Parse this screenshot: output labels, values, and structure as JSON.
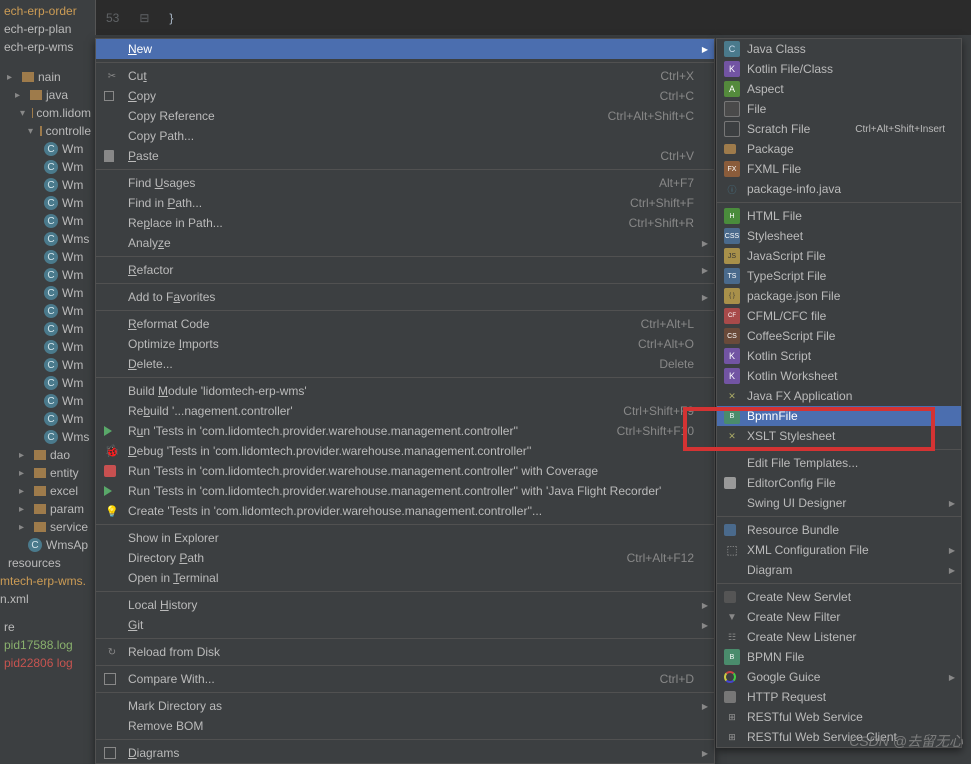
{
  "editor": {
    "line_number": "53",
    "code": "}"
  },
  "tree": {
    "projects": [
      {
        "label": "ech-erp-order",
        "cls": "ylw"
      },
      {
        "label": "ech-erp-plan",
        "cls": ""
      },
      {
        "label": "ech-erp-wms",
        "cls": ""
      }
    ],
    "main_nodes": [
      {
        "label": "nain",
        "indent": 0,
        "icon": "fld"
      },
      {
        "label": "java",
        "indent": 8,
        "icon": "fld"
      },
      {
        "label": "com.lidom",
        "indent": 16,
        "icon": "fld-open"
      },
      {
        "label": "controlle",
        "indent": 24,
        "icon": "fld-open"
      }
    ],
    "wms_items": [
      "Wm",
      "Wm",
      "Wm",
      "Wm",
      "Wm",
      "Wms",
      "Wm",
      "Wm",
      "Wm",
      "Wm",
      "Wm",
      "Wm",
      "Wm",
      "Wm",
      "Wm",
      "Wm",
      "Wms"
    ],
    "dao_folders": [
      {
        "label": "dao"
      },
      {
        "label": "entity"
      },
      {
        "label": "excel"
      },
      {
        "label": "param"
      },
      {
        "label": "service"
      }
    ],
    "wms_app": "WmsAp",
    "resources": "resources",
    "erp_wms": "mtech-erp-wms.",
    "xml": "n.xml",
    "re_label": "re",
    "logs": [
      {
        "label": "pid17588.log",
        "cls": "grn"
      },
      {
        "label": "pid22806 log",
        "cls": "red"
      }
    ]
  },
  "ctx_groups": [
    [
      {
        "label": "New",
        "underline_idx": 0,
        "shortcut": "",
        "arrow": true,
        "highlight": true
      }
    ],
    [
      {
        "label": "Cut",
        "underline_idx": 2,
        "shortcut": "Ctrl+X",
        "icon": "scissors"
      },
      {
        "label": "Copy",
        "underline_idx": 0,
        "shortcut": "Ctrl+C",
        "icon": "copy"
      },
      {
        "label": "Copy Reference",
        "shortcut": "Ctrl+Alt+Shift+C"
      },
      {
        "label": "Copy Path...",
        "shortcut": ""
      },
      {
        "label": "Paste",
        "underline_idx": 0,
        "shortcut": "Ctrl+V",
        "icon": "paste"
      }
    ],
    [
      {
        "label": "Find Usages",
        "underline_idx": 5,
        "shortcut": "Alt+F7"
      },
      {
        "label": "Find in Path...",
        "underline_idx": 8,
        "shortcut": "Ctrl+Shift+F"
      },
      {
        "label": "Replace in Path...",
        "underline_idx": 2,
        "shortcut": "Ctrl+Shift+R"
      },
      {
        "label": "Analyze",
        "underline_idx": 5,
        "shortcut": "",
        "arrow": true
      }
    ],
    [
      {
        "label": "Refactor",
        "underline_idx": 0,
        "shortcut": "",
        "arrow": true
      }
    ],
    [
      {
        "label": "Add to Favorites",
        "underline_idx": 8,
        "shortcut": "",
        "arrow": true
      }
    ],
    [
      {
        "label": "Reformat Code",
        "underline_idx": 0,
        "shortcut": "Ctrl+Alt+L"
      },
      {
        "label": "Optimize Imports",
        "underline_idx": 9,
        "shortcut": "Ctrl+Alt+O"
      },
      {
        "label": "Delete...",
        "underline_idx": 0,
        "shortcut": "Delete"
      }
    ],
    [
      {
        "label": "Build Module 'lidomtech-erp-wms'",
        "underline_idx": 6
      },
      {
        "label": "Rebuild '...nagement.controller'",
        "underline_idx": 2,
        "shortcut": "Ctrl+Shift+F9"
      },
      {
        "label": "Run 'Tests in 'com.lidomtech.provider.warehouse.management.controller''",
        "underline_idx": 1,
        "shortcut": "Ctrl+Shift+F10",
        "icon": "run"
      },
      {
        "label": "Debug 'Tests in 'com.lidomtech.provider.warehouse.management.controller''",
        "underline_idx": 0,
        "icon": "debug"
      },
      {
        "label": "Run 'Tests in 'com.lidomtech.provider.warehouse.management.controller'' with Coverage",
        "underline_idx": 83,
        "icon": "cov"
      },
      {
        "label": "Run 'Tests in 'com.lidomtech.provider.warehouse.management.controller'' with 'Java Flight Recorder'",
        "icon": "run"
      },
      {
        "label": "Create 'Tests in 'com.lidomtech.provider.warehouse.management.controller''...",
        "icon": "bulb"
      }
    ],
    [
      {
        "label": "Show in Explorer"
      },
      {
        "label": "Directory Path",
        "underline_idx": 10,
        "shortcut": "Ctrl+Alt+F12"
      },
      {
        "label": "Open in Terminal",
        "underline_idx": 8
      }
    ],
    [
      {
        "label": "Local History",
        "underline_idx": 6,
        "arrow": true
      },
      {
        "label": "Git",
        "underline_idx": 0,
        "arrow": true
      }
    ],
    [
      {
        "label": "Reload from Disk",
        "icon": "sync"
      }
    ],
    [
      {
        "label": "Compare With...",
        "shortcut": "Ctrl+D",
        "icon": "diag"
      }
    ],
    [
      {
        "label": "Mark Directory as",
        "arrow": true
      },
      {
        "label": "Remove BOM"
      }
    ],
    [
      {
        "label": "Diagrams",
        "underline_idx": 0,
        "arrow": true,
        "icon": "diag"
      }
    ]
  ],
  "submenu": [
    [
      {
        "label": "Java Class",
        "icon": "i-java",
        "icon_text": "C"
      },
      {
        "label": "Kotlin File/Class",
        "icon": "i-kotlin",
        "icon_text": "K"
      },
      {
        "label": "Aspect",
        "icon": "i-aspect",
        "icon_text": "A"
      },
      {
        "label": "File",
        "icon": "i-file"
      },
      {
        "label": "Scratch File",
        "icon": "i-scratch",
        "shortcut": "Ctrl+Alt+Shift+Insert"
      },
      {
        "label": "Package",
        "icon": "i-pkg"
      },
      {
        "label": "FXML File",
        "icon": "i-fxml",
        "icon_text": "FX"
      },
      {
        "label": "package-info.java",
        "icon": "i-pkginfo"
      }
    ],
    [
      {
        "label": "HTML File",
        "icon": "i-html",
        "icon_text": "H"
      },
      {
        "label": "Stylesheet",
        "icon": "i-css",
        "icon_text": "CSS"
      },
      {
        "label": "JavaScript File",
        "icon": "i-js",
        "icon_text": "JS"
      },
      {
        "label": "TypeScript File",
        "icon": "i-ts",
        "icon_text": "TS"
      },
      {
        "label": "package.json File",
        "icon": "i-json",
        "icon_text": "{ }"
      },
      {
        "label": "CFML/CFC file",
        "icon": "i-cfml",
        "icon_text": "CF"
      },
      {
        "label": "CoffeeScript File",
        "icon": "i-coffee",
        "icon_text": "CS"
      },
      {
        "label": "Kotlin Script",
        "icon": "i-kotlin",
        "icon_text": "K"
      },
      {
        "label": "Kotlin Worksheet",
        "icon": "i-ktw",
        "icon_text": "K"
      },
      {
        "label": "Java FX Application",
        "icon": "i-xslt"
      },
      {
        "label": "BpmnFile",
        "icon": "i-bpmn",
        "icon_text": "B",
        "highlight": true
      },
      {
        "label": "XSLT Stylesheet",
        "icon": "i-xslt"
      }
    ],
    [
      {
        "label": "Edit File Templates..."
      },
      {
        "label": "EditorConfig File",
        "icon": "i-edcfg"
      },
      {
        "label": "Swing UI Designer",
        "arrow": true
      }
    ],
    [
      {
        "label": "Resource Bundle",
        "icon": "i-rb"
      },
      {
        "label": "XML Configuration File",
        "icon": "i-xml",
        "arrow": true
      },
      {
        "label": "Diagram",
        "arrow": true
      }
    ],
    [
      {
        "label": "Create New Servlet",
        "icon": "i-servlet"
      },
      {
        "label": "Create New Filter",
        "icon": "i-filter"
      },
      {
        "label": "Create New Listener",
        "icon": "i-listen"
      },
      {
        "label": "BPMN File",
        "icon": "i-bpmn",
        "icon_text": "B"
      },
      {
        "label": "Google Guice",
        "icon": "i-guice",
        "arrow": true
      },
      {
        "label": "HTTP Request",
        "icon": "i-http"
      },
      {
        "label": "RESTful Web Service",
        "icon": "i-rest"
      },
      {
        "label": "RESTful Web Service Client",
        "icon": "i-rest"
      }
    ]
  ],
  "watermark": "CSDN @去留无心"
}
